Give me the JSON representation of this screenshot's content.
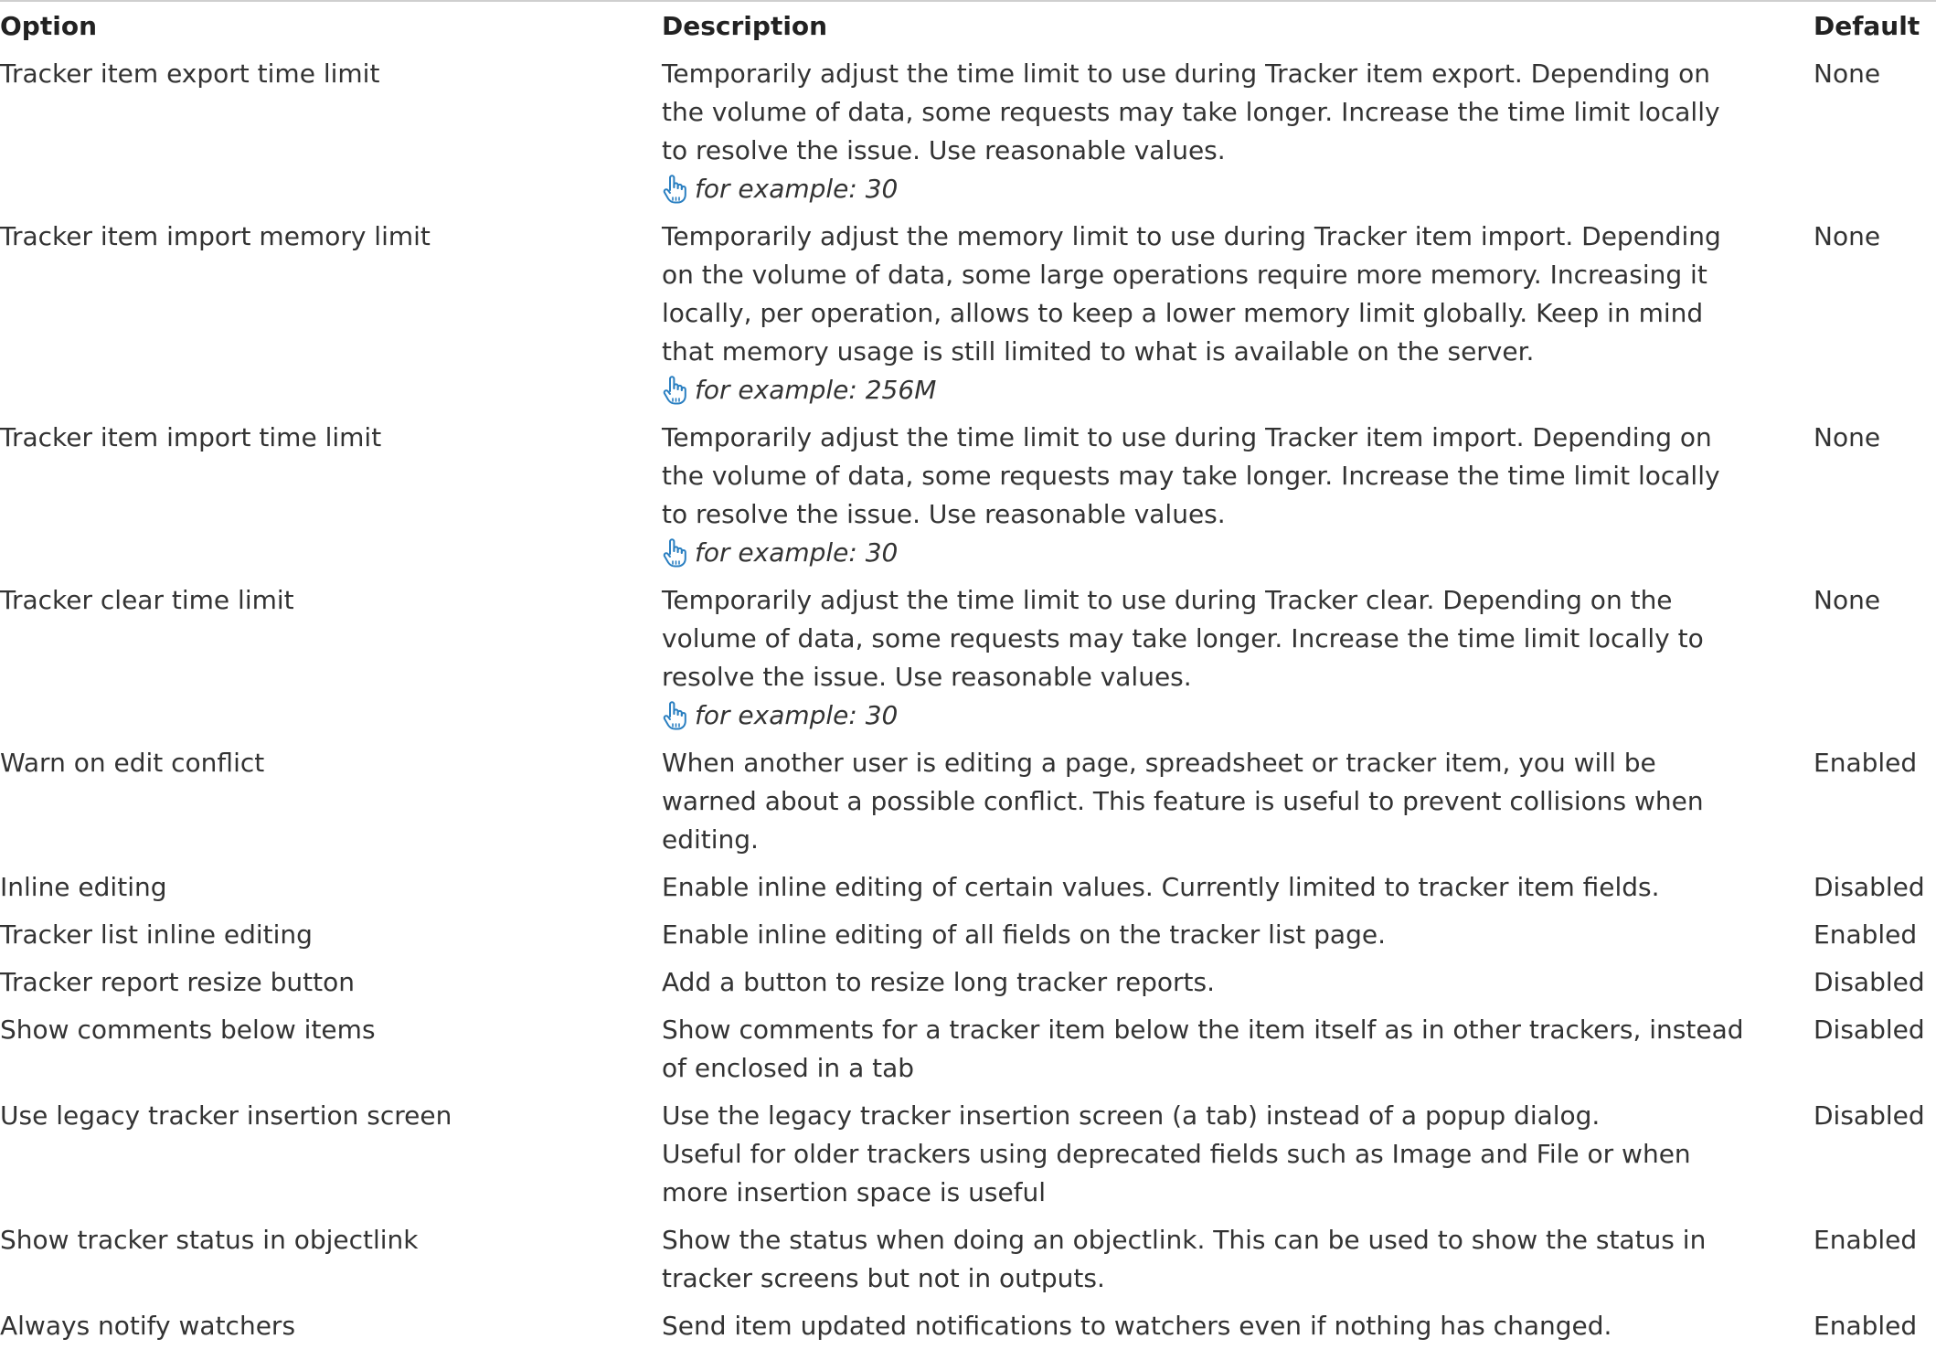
{
  "table": {
    "headers": {
      "option": "Option",
      "description": "Description",
      "default": "Default"
    },
    "rows": [
      {
        "option": "Tracker item export time limit",
        "description": "Temporarily adjust the time limit to use during Tracker item export. Depending on\nthe volume of data, some requests may take longer. Increase the time limit locally\nto resolve the issue. Use reasonable values.",
        "example": "for example: 30",
        "default": "None"
      },
      {
        "option": "Tracker item import memory limit",
        "description": "Temporarily adjust the memory limit to use during Tracker item import. Depending\non the volume of data, some large operations require more memory. Increasing it\nlocally, per operation, allows to keep a lower memory limit globally. Keep in mind\nthat memory usage is still limited to what is available on the server.",
        "example": "for example: 256M",
        "default": "None"
      },
      {
        "option": "Tracker item import time limit",
        "description": "Temporarily adjust the time limit to use during Tracker item import. Depending on\nthe volume of data, some requests may take longer. Increase the time limit locally\nto resolve the issue. Use reasonable values.",
        "example": "for example: 30",
        "default": "None"
      },
      {
        "option": "Tracker clear time limit",
        "description": "Temporarily adjust the time limit to use during Tracker clear. Depending on the\nvolume of data, some requests may take longer. Increase the time limit locally to\nresolve the issue. Use reasonable values.",
        "example": "for example: 30",
        "default": "None"
      },
      {
        "option": "Warn on edit conflict",
        "description": "When another user is editing a page, spreadsheet or tracker item, you will be\nwarned about a possible conflict. This feature is useful to prevent collisions when\nediting.",
        "default": "Enabled"
      },
      {
        "option": "Inline editing",
        "description": "Enable inline editing of certain values. Currently limited to tracker item fields.",
        "default": "Disabled"
      },
      {
        "option": "Tracker list inline editing",
        "description": "Enable inline editing of all fields on the tracker list page.",
        "default": "Enabled"
      },
      {
        "option": "Tracker report resize button",
        "description": "Add a button to resize long tracker reports.",
        "default": "Disabled"
      },
      {
        "option": "Show comments below items",
        "description": "Show comments for a tracker item below the item itself as in other trackers, instead\nof enclosed in a tab",
        "default": "Disabled"
      },
      {
        "option": "Use legacy tracker insertion screen",
        "description": "Use the legacy tracker insertion screen (a tab) instead of a popup dialog.\nUseful for older trackers using deprecated fields such as Image and File or when\nmore insertion space is useful",
        "default": "Disabled"
      },
      {
        "option": "Show tracker status in objectlink",
        "description": "Show the status when doing an objectlink. This can be used to show the status in\ntracker screens but not in outputs.",
        "default": "Enabled"
      },
      {
        "option": "Always notify watchers",
        "description": "Send item updated notifications to watchers even if nothing has changed.",
        "default": "Enabled"
      }
    ]
  },
  "icons": {
    "example": "pointing-hand-icon"
  },
  "colors": {
    "example_icon": "#2a7fc1",
    "text": "#333333",
    "header_text": "#222222",
    "top_rule": "#cfcfcf"
  }
}
